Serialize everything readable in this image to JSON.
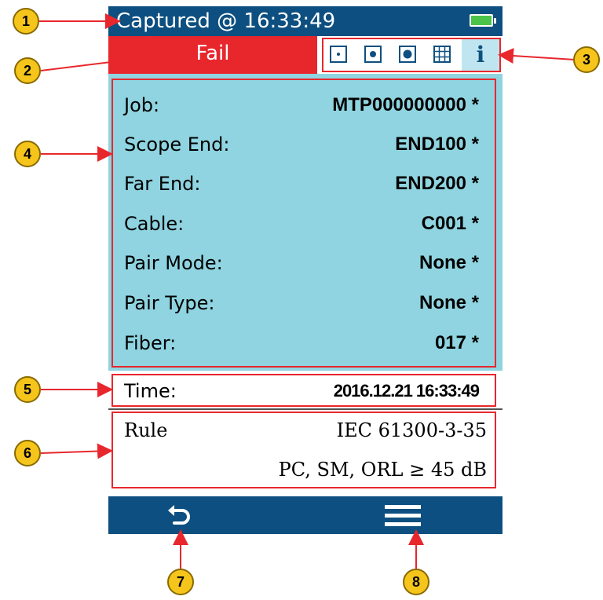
{
  "status_bar": {
    "captured_text": "Captured @ 16:33:49",
    "battery_icon": "battery-full-icon"
  },
  "result": {
    "label": "Fail",
    "color": "#e8272d"
  },
  "view_toolbar": {
    "buttons": [
      "fiber-small-icon",
      "fiber-medium-icon",
      "fiber-large-icon",
      "grid-view-icon",
      "info-icon"
    ],
    "info_glyph": "i"
  },
  "info": {
    "rows": [
      {
        "label": "Job:",
        "value": "MTP000000000 *"
      },
      {
        "label": "Scope End:",
        "value": "END100 *"
      },
      {
        "label": "Far End:",
        "value": "END200 *"
      },
      {
        "label": "Cable:",
        "value": "C001 *"
      },
      {
        "label": "Pair Mode:",
        "value": "None *"
      },
      {
        "label": "Pair Type:",
        "value": "None *"
      },
      {
        "label": "Fiber:",
        "value": "017 *"
      }
    ]
  },
  "time": {
    "label": "Time:",
    "value": "2016.12.21 16:33:49"
  },
  "rule": {
    "label": "Rule",
    "standard": "IEC 61300-3-35",
    "criteria": "PC, SM, ORL ≥ 45 dB"
  },
  "nav": {
    "back_icon": "back-arrow-icon",
    "menu_icon": "menu-icon"
  },
  "callouts": [
    "1",
    "2",
    "3",
    "4",
    "5",
    "6",
    "7",
    "8"
  ],
  "colors": {
    "header_blue": "#0d4f80",
    "panel_cyan": "#8fd4e0",
    "fail_red": "#e8272d",
    "callout_yellow": "#f5c51c"
  }
}
